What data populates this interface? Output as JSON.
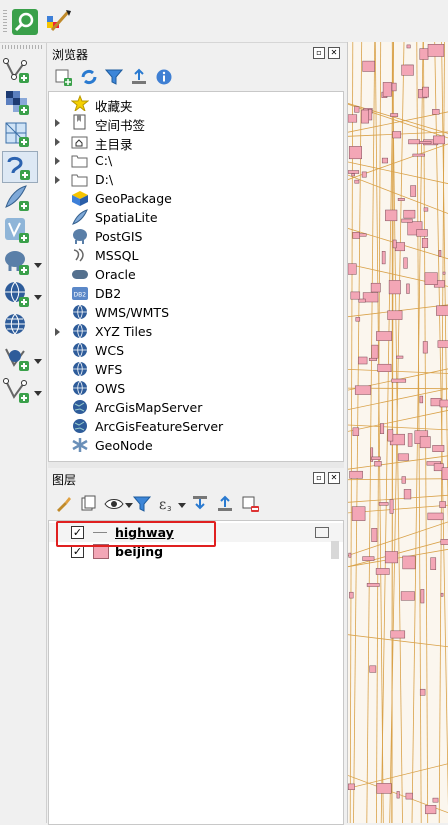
{
  "browser_panel": {
    "title": "浏览器",
    "items": [
      {
        "label": "收藏夹",
        "icon": "star-icon",
        "expandable": false
      },
      {
        "label": "空间书签",
        "icon": "spatial-bookmark-icon",
        "expandable": true
      },
      {
        "label": "主目录",
        "icon": "home-folder-icon",
        "expandable": true
      },
      {
        "label": "C:\\",
        "icon": "folder-icon",
        "expandable": true
      },
      {
        "label": "D:\\",
        "icon": "folder-icon",
        "expandable": true
      },
      {
        "label": "GeoPackage",
        "icon": "geopackage-icon",
        "expandable": false
      },
      {
        "label": "SpatiaLite",
        "icon": "spatialite-feather-icon",
        "expandable": false
      },
      {
        "label": "PostGIS",
        "icon": "postgis-elephant-icon",
        "expandable": false
      },
      {
        "label": "MSSQL",
        "icon": "mssql-icon",
        "expandable": false
      },
      {
        "label": "Oracle",
        "icon": "oracle-icon",
        "expandable": false
      },
      {
        "label": "DB2",
        "icon": "db2-icon",
        "expandable": false
      },
      {
        "label": "WMS/WMTS",
        "icon": "globe-icon",
        "expandable": false
      },
      {
        "label": "XYZ Tiles",
        "icon": "globe-icon",
        "expandable": true
      },
      {
        "label": "WCS",
        "icon": "globe-icon",
        "expandable": false
      },
      {
        "label": "WFS",
        "icon": "globe-icon",
        "expandable": false
      },
      {
        "label": "OWS",
        "icon": "globe-icon",
        "expandable": false
      },
      {
        "label": "ArcGisMapServer",
        "icon": "arcgis-globe-icon",
        "expandable": false
      },
      {
        "label": "ArcGisFeatureServer",
        "icon": "arcgis-globe-icon",
        "expandable": false
      },
      {
        "label": "GeoNode",
        "icon": "geonode-icon",
        "expandable": false
      }
    ]
  },
  "layers_panel": {
    "title": "图层",
    "layers": [
      {
        "name": "highway",
        "checked": true,
        "symbol": "line",
        "highlighted": true
      },
      {
        "name": "beijing",
        "checked": true,
        "symbol": "polygon",
        "color": "#f3a6b6",
        "highlighted": false
      }
    ]
  },
  "colors": {
    "highlight_box": "#e02020",
    "polygon_fill": "#f3a6b6",
    "road_line": "#d9a24a",
    "map_bg": "#fbf6ee"
  }
}
